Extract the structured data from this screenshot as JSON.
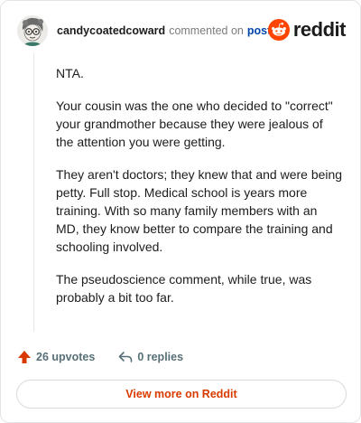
{
  "header": {
    "author": "candycoatedcoward",
    "commented_text": "commented on",
    "post_link": "post",
    "brand": "reddit"
  },
  "comment": {
    "paragraphs": [
      "NTA.",
      "Your cousin was the one who decided to \"correct\" your grandmother because they were jealous of the attention you were getting.",
      "They aren't doctors; they knew that and were being petty. Full stop. Medical school is years more training. With so many family members with an MD, they know better to compare the training and schooling involved.",
      "The pseudoscience comment, while true, was probably a bit too far."
    ]
  },
  "actions": {
    "upvotes": "26 upvotes",
    "replies": "0 replies"
  },
  "footer": {
    "view_more": "View more on Reddit"
  },
  "colors": {
    "brand_orange": "#ff4500",
    "upvote": "#d93a00",
    "link": "#0045ac"
  }
}
